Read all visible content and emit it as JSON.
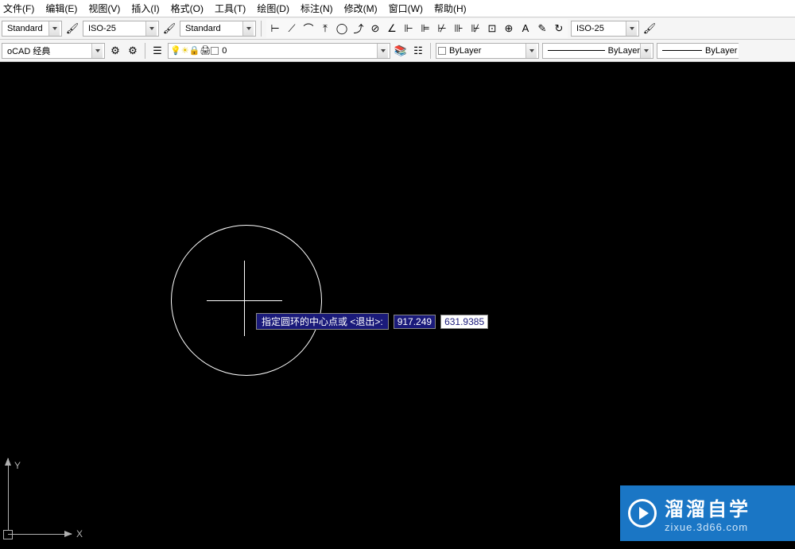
{
  "menu": {
    "file": "文件(F)",
    "edit": "编辑(E)",
    "view": "视图(V)",
    "insert": "插入(I)",
    "format": "格式(O)",
    "tools": "工具(T)",
    "draw": "绘图(D)",
    "annotation": "标注(N)",
    "modify": "修改(M)",
    "window": "窗口(W)",
    "help": "帮助(H)"
  },
  "toolbar1": {
    "style1": "Standard",
    "dim_style": "ISO-25",
    "text_style": "Standard",
    "dim_style2": "ISO-25"
  },
  "toolbar2": {
    "workspace": "oCAD 经典",
    "layer_state": "0",
    "layer_prop": "ByLayer",
    "lineweight": "ByLayer",
    "linetype": "ByLayer"
  },
  "dynamic_input": {
    "prompt": "指定圆环的中心点或 <退出>: ",
    "x": "917.249",
    "y": "631.9385"
  },
  "ucs": {
    "x": "X",
    "y": "Y"
  },
  "watermark": {
    "title": "溜溜自学",
    "url": "zixue.3d66.com"
  },
  "icons": {
    "brush": "🖌",
    "dim_linear": "⊢",
    "dim_aligned": "⟋",
    "dim_arc": "⌒",
    "dim_ordinate": "⤒",
    "dim_radius": "◯",
    "dim_jogged": "⤴",
    "dim_diameter": "⊘",
    "dim_angular": "∠",
    "quick_dim": "⊩",
    "baseline": "⊫",
    "continue": "⊬",
    "dim_space": "⊪",
    "dim_break": "⊮",
    "tolerance": "⊡",
    "center_mark": "⊕",
    "dim_edit": "A",
    "dim_text_edit": "✎",
    "update": "↻",
    "gear": "⚙",
    "gear2": "⚙",
    "layers_stack": "☰",
    "bulb": "💡",
    "sun": "☀",
    "lock": "🔒",
    "print": "🖨",
    "color_sq": "□",
    "layers_icon": "📚",
    "states": "☷",
    "bylayer_sq": "□"
  }
}
